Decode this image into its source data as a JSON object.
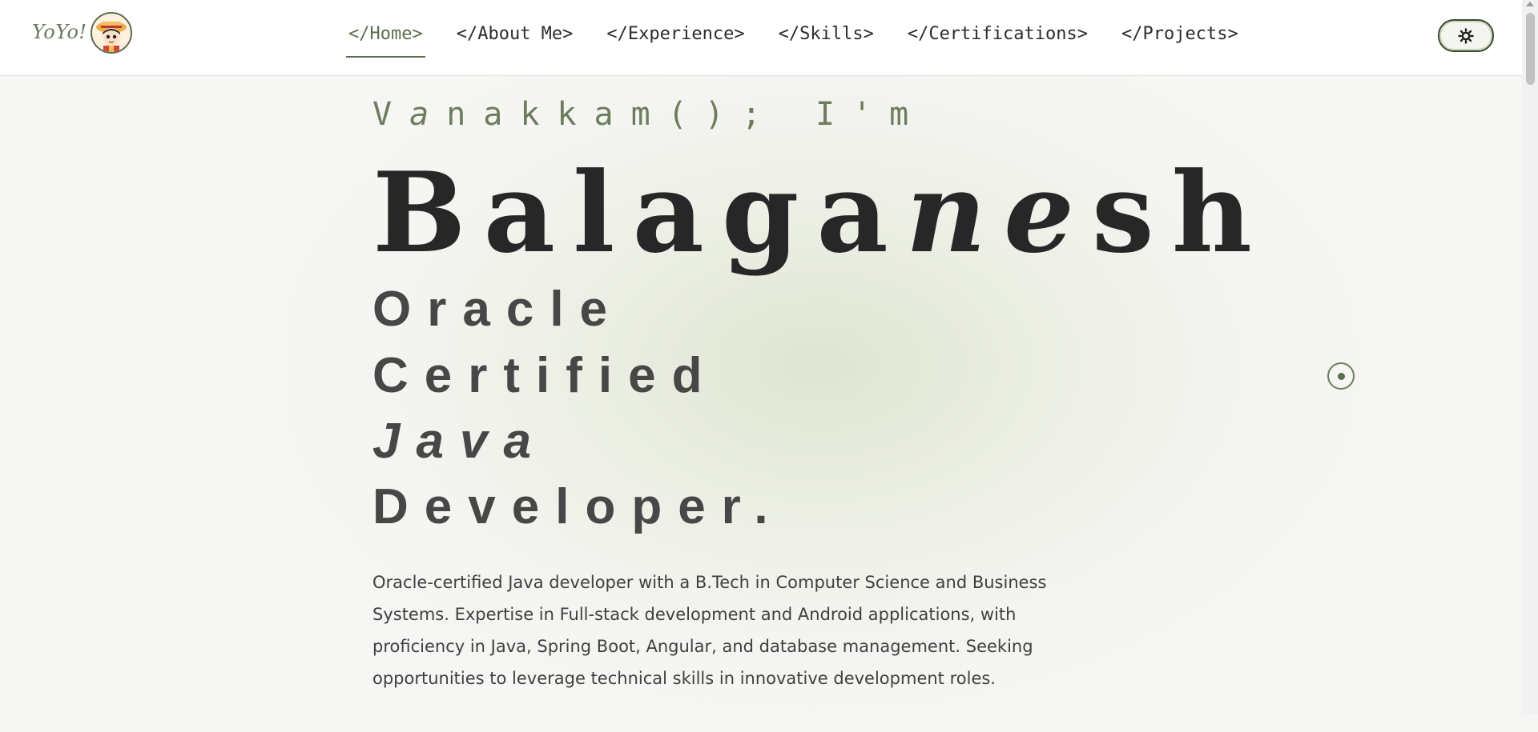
{
  "brand": {
    "logo_text": "YoYo!",
    "avatar_icon": "anime-avatar-icon"
  },
  "nav": {
    "items": [
      {
        "label": "</Home>",
        "active": true
      },
      {
        "label": "</About Me>",
        "active": false
      },
      {
        "label": "</Experience>",
        "active": false
      },
      {
        "label": "</Skills>",
        "active": false
      },
      {
        "label": "</Certifications>",
        "active": false
      },
      {
        "label": "</Projects>",
        "active": false
      }
    ]
  },
  "theme_toggle": {
    "icon": "sun-icon"
  },
  "hero": {
    "greeting_a": "V",
    "greeting_b": "a",
    "greeting_c": "nakkam(); I'm",
    "name_a": "Balaga",
    "name_b": "ne",
    "name_c": "sh",
    "role_lines": [
      "Oracle",
      "Certified",
      "Java",
      "Developer."
    ],
    "description": "Oracle-certified Java developer with a B.Tech in Computer Science and Business Systems. Expertise in Full-stack development and Android applications, with proficiency in Java, Spring Boot, Angular, and database management. Seeking opportunities to leverage technical skills in innovative development roles."
  },
  "colors": {
    "accent": "#5b6e4b",
    "background": "#f6f6f4",
    "text": "#2b2b2b"
  }
}
